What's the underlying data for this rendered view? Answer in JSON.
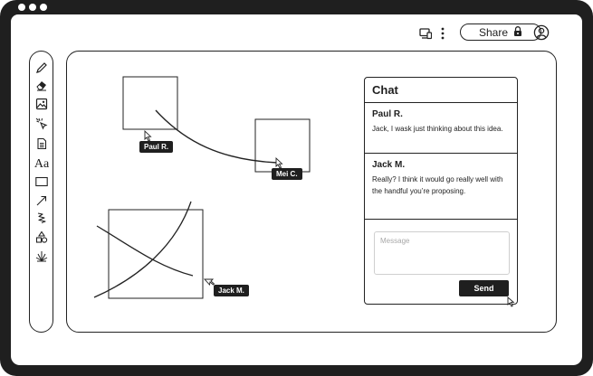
{
  "window": {
    "controls": [
      "dot",
      "dot",
      "dot"
    ]
  },
  "topbar": {
    "share_label": "Share",
    "icons": [
      "screen-share-icon",
      "more-vertical-icon",
      "lock-icon",
      "user-icon"
    ]
  },
  "toolbar": {
    "tools": [
      {
        "name": "pen",
        "icon": "pencil-icon"
      },
      {
        "name": "eraser",
        "icon": "eraser-icon"
      },
      {
        "name": "image",
        "icon": "image-icon"
      },
      {
        "name": "laser",
        "icon": "laser-pointer-icon"
      },
      {
        "name": "document",
        "icon": "document-icon"
      },
      {
        "name": "text",
        "label": "Aa"
      },
      {
        "name": "rectangle",
        "icon": "rectangle-icon"
      },
      {
        "name": "arrow",
        "icon": "arrow-icon"
      },
      {
        "name": "squiggle",
        "icon": "squiggle-icon"
      },
      {
        "name": "shapes",
        "icon": "shapes-icon"
      },
      {
        "name": "stamp",
        "icon": "sparkle-icon"
      }
    ]
  },
  "canvas": {
    "collaborators": [
      {
        "name": "Paul R."
      },
      {
        "name": "Mei C."
      },
      {
        "name": "Jack M."
      }
    ]
  },
  "chat": {
    "title": "Chat",
    "messages": [
      {
        "author": "Paul R.",
        "text": "Jack, I wask just thinking about this idea."
      },
      {
        "author": "Jack M.",
        "text": "Really? I think it would go really well with the handful you’re proposing."
      }
    ],
    "input_placeholder": "Message",
    "send_label": "Send"
  }
}
